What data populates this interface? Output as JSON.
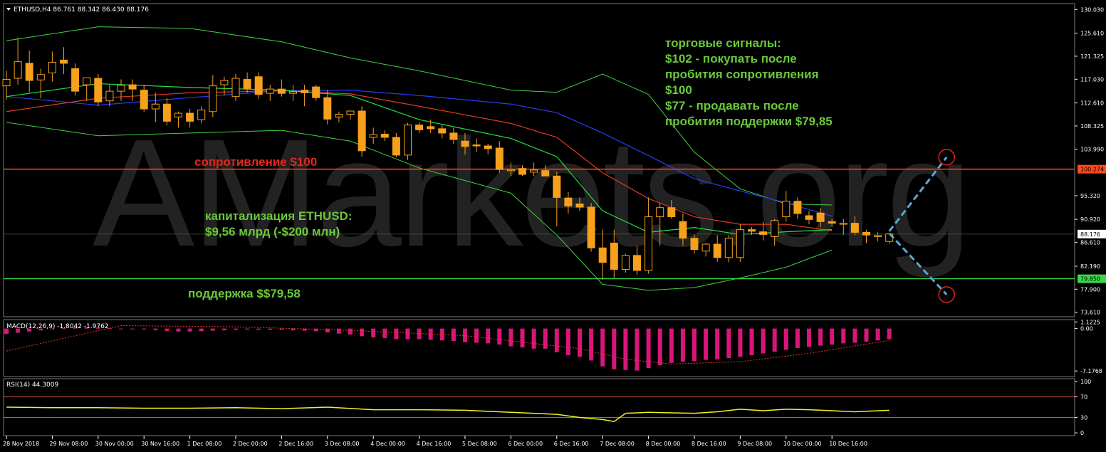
{
  "chart_data": [
    {
      "type": "candlestick",
      "symbol_header": "ETHUSD,H4  86.761 88.342 86.430 88.176",
      "watermark": "AMarkets.org",
      "price_axis_ticks": [
        "130.030",
        "125.610",
        "121.325",
        "117.030",
        "112.610",
        "108.325",
        "103.990",
        "95.320",
        "90.920",
        "86.610",
        "82.190",
        "77.900",
        "73.610"
      ],
      "price_axis_values": [
        130.03,
        125.61,
        121.325,
        117.03,
        112.61,
        108.325,
        103.99,
        95.32,
        90.92,
        86.61,
        82.19,
        77.9,
        73.61
      ],
      "ylim": [
        72.9,
        131.0
      ],
      "time_labels": [
        "28 Nov 2018",
        "29 Nov 08:00",
        "30 Nov 00:00",
        "30 Nov 16:00",
        "1 Dec 08:00",
        "2 Dec 00:00",
        "2 Dec 16:00",
        "3 Dec 08:00",
        "4 Dec 00:00",
        "4 Dec 16:00",
        "5 Dec 08:00",
        "6 Dec 00:00",
        "6 Dec 16:00",
        "7 Dec 08:00",
        "8 Dec 00:00",
        "8 Dec 16:00",
        "9 Dec 08:00",
        "10 Dec 00:00",
        "10 Dec 16:00"
      ],
      "time_label_index": [
        0,
        4,
        8,
        12,
        16,
        20,
        24,
        28,
        32,
        36,
        40,
        44,
        48,
        52,
        56,
        60,
        64,
        68,
        72
      ],
      "candles": [
        {
          "o": 115.8,
          "h": 118.6,
          "l": 113.2,
          "c": 117.0
        },
        {
          "o": 117.2,
          "h": 124.8,
          "l": 116.0,
          "c": 120.3
        },
        {
          "o": 120.0,
          "h": 122.4,
          "l": 114.6,
          "c": 116.8
        },
        {
          "o": 116.9,
          "h": 119.0,
          "l": 113.5,
          "c": 117.9
        },
        {
          "o": 118.2,
          "h": 122.2,
          "l": 116.6,
          "c": 120.2
        },
        {
          "o": 120.6,
          "h": 123.0,
          "l": 118.0,
          "c": 120.0
        },
        {
          "o": 119.0,
          "h": 120.0,
          "l": 114.0,
          "c": 114.8
        },
        {
          "o": 116.0,
          "h": 117.0,
          "l": 113.0,
          "c": 117.3
        },
        {
          "o": 117.2,
          "h": 118.0,
          "l": 112.0,
          "c": 112.8
        },
        {
          "o": 113.0,
          "h": 116.0,
          "l": 112.0,
          "c": 114.8
        },
        {
          "o": 114.8,
          "h": 117.0,
          "l": 113.0,
          "c": 115.9
        },
        {
          "o": 116.0,
          "h": 117.0,
          "l": 113.0,
          "c": 115.2
        },
        {
          "o": 115.0,
          "h": 116.0,
          "l": 111.0,
          "c": 111.5
        },
        {
          "o": 111.5,
          "h": 114.5,
          "l": 109.0,
          "c": 112.4
        },
        {
          "o": 112.4,
          "h": 113.5,
          "l": 108.4,
          "c": 109.2
        },
        {
          "o": 110.0,
          "h": 111.0,
          "l": 108.0,
          "c": 110.7
        },
        {
          "o": 110.7,
          "h": 111.5,
          "l": 108.0,
          "c": 109.2
        },
        {
          "o": 109.5,
          "h": 112.0,
          "l": 108.8,
          "c": 111.3
        },
        {
          "o": 111.0,
          "h": 117.8,
          "l": 110.0,
          "c": 115.8
        },
        {
          "o": 116.0,
          "h": 117.5,
          "l": 114.0,
          "c": 116.8
        },
        {
          "o": 113.8,
          "h": 118.0,
          "l": 113.0,
          "c": 117.2
        },
        {
          "o": 117.0,
          "h": 118.3,
          "l": 114.5,
          "c": 115.3
        },
        {
          "o": 117.5,
          "h": 118.3,
          "l": 113.4,
          "c": 114.2
        },
        {
          "o": 114.4,
          "h": 116.0,
          "l": 113.0,
          "c": 115.2
        },
        {
          "o": 115.2,
          "h": 117.0,
          "l": 113.8,
          "c": 114.4
        },
        {
          "o": 114.4,
          "h": 116.0,
          "l": 113.0,
          "c": 114.7
        },
        {
          "o": 115.0,
          "h": 116.0,
          "l": 112.0,
          "c": 114.5
        },
        {
          "o": 115.6,
          "h": 116.0,
          "l": 113.0,
          "c": 113.6
        },
        {
          "o": 113.6,
          "h": 115.0,
          "l": 108.6,
          "c": 109.6
        },
        {
          "o": 110.0,
          "h": 111.0,
          "l": 109.0,
          "c": 110.5
        },
        {
          "o": 110.5,
          "h": 111.0,
          "l": 109.5,
          "c": 111.1
        },
        {
          "o": 111.1,
          "h": 112.0,
          "l": 102.6,
          "c": 103.7
        },
        {
          "o": 106.2,
          "h": 108.0,
          "l": 105.0,
          "c": 106.7
        },
        {
          "o": 106.8,
          "h": 107.5,
          "l": 105.5,
          "c": 106.2
        },
        {
          "o": 106.2,
          "h": 107.0,
          "l": 102.5,
          "c": 102.9
        },
        {
          "o": 102.9,
          "h": 108.9,
          "l": 102.0,
          "c": 108.5
        },
        {
          "o": 108.5,
          "h": 109.0,
          "l": 107.0,
          "c": 107.6
        },
        {
          "o": 108.2,
          "h": 109.5,
          "l": 107.0,
          "c": 107.8
        },
        {
          "o": 107.8,
          "h": 108.5,
          "l": 106.0,
          "c": 107.0
        },
        {
          "o": 107.0,
          "h": 108.0,
          "l": 105.0,
          "c": 105.8
        },
        {
          "o": 105.5,
          "h": 107.0,
          "l": 103.0,
          "c": 104.5
        },
        {
          "o": 104.8,
          "h": 106.0,
          "l": 103.5,
          "c": 104.6
        },
        {
          "o": 104.6,
          "h": 105.0,
          "l": 103.0,
          "c": 104.1
        },
        {
          "o": 104.2,
          "h": 105.5,
          "l": 99.6,
          "c": 100.2
        },
        {
          "o": 100.0,
          "h": 101.5,
          "l": 99.0,
          "c": 100.2
        },
        {
          "o": 100.4,
          "h": 101.0,
          "l": 99.0,
          "c": 99.3
        },
        {
          "o": 99.7,
          "h": 101.5,
          "l": 99.0,
          "c": 100.1
        },
        {
          "o": 100.0,
          "h": 101.0,
          "l": 99.0,
          "c": 99.0
        },
        {
          "o": 99.0,
          "h": 99.8,
          "l": 89.6,
          "c": 95.0
        },
        {
          "o": 94.9,
          "h": 96.0,
          "l": 92.0,
          "c": 93.4
        },
        {
          "o": 93.8,
          "h": 95.0,
          "l": 92.5,
          "c": 93.2
        },
        {
          "o": 93.2,
          "h": 94.0,
          "l": 84.9,
          "c": 85.6
        },
        {
          "o": 85.6,
          "h": 89.0,
          "l": 79.7,
          "c": 82.9
        },
        {
          "o": 86.5,
          "h": 89.0,
          "l": 80.0,
          "c": 81.6
        },
        {
          "o": 81.6,
          "h": 84.5,
          "l": 81.0,
          "c": 84.2
        },
        {
          "o": 84.2,
          "h": 86.0,
          "l": 80.5,
          "c": 81.4
        },
        {
          "o": 81.4,
          "h": 95.0,
          "l": 80.8,
          "c": 91.4
        },
        {
          "o": 91.4,
          "h": 94.0,
          "l": 86.0,
          "c": 93.1
        },
        {
          "o": 93.1,
          "h": 94.5,
          "l": 91.0,
          "c": 91.4
        },
        {
          "o": 90.5,
          "h": 92.0,
          "l": 86.0,
          "c": 87.4
        },
        {
          "o": 87.4,
          "h": 88.0,
          "l": 84.5,
          "c": 85.3
        },
        {
          "o": 85.0,
          "h": 86.5,
          "l": 84.0,
          "c": 86.3
        },
        {
          "o": 86.3,
          "h": 88.0,
          "l": 83.0,
          "c": 83.8
        },
        {
          "o": 83.8,
          "h": 88.0,
          "l": 82.9,
          "c": 87.4
        },
        {
          "o": 83.8,
          "h": 90.0,
          "l": 83.0,
          "c": 89.0
        },
        {
          "o": 89.0,
          "h": 89.5,
          "l": 88.0,
          "c": 88.7
        },
        {
          "o": 88.6,
          "h": 90.5,
          "l": 87.0,
          "c": 88.1
        },
        {
          "o": 87.7,
          "h": 91.0,
          "l": 86.0,
          "c": 90.7
        },
        {
          "o": 91.4,
          "h": 96.2,
          "l": 90.5,
          "c": 94.3
        },
        {
          "o": 94.3,
          "h": 95.0,
          "l": 91.0,
          "c": 92.0
        },
        {
          "o": 91.6,
          "h": 92.5,
          "l": 90.0,
          "c": 90.9
        },
        {
          "o": 92.1,
          "h": 93.0,
          "l": 89.5,
          "c": 90.5
        },
        {
          "o": 90.5,
          "h": 91.0,
          "l": 89.5,
          "c": 90.2
        },
        {
          "o": 90.2,
          "h": 91.0,
          "l": 88.0,
          "c": 90.2
        },
        {
          "o": 90.2,
          "h": 91.5,
          "l": 88.0,
          "c": 88.5
        },
        {
          "o": 88.5,
          "h": 89.0,
          "l": 86.5,
          "c": 88.0
        },
        {
          "o": 87.8,
          "h": 88.5,
          "l": 86.8,
          "c": 87.9
        },
        {
          "o": 86.8,
          "h": 88.3,
          "l": 86.4,
          "c": 88.2
        }
      ],
      "bollinger_upper": {
        "x": [
          0,
          8,
          16,
          24,
          30,
          36,
          44,
          48,
          52,
          56,
          60,
          64,
          68,
          72
        ],
        "y": [
          124.2,
          126.8,
          126.5,
          124.0,
          121.0,
          118.6,
          115.0,
          114.6,
          118.0,
          114.2,
          103.4,
          96.6,
          93.8,
          93.6
        ]
      },
      "bollinger_lower": {
        "x": [
          0,
          8,
          16,
          24,
          30,
          36,
          44,
          48,
          52,
          56,
          60,
          64,
          68,
          72
        ],
        "y": [
          109.0,
          106.5,
          107.0,
          107.5,
          105.5,
          100.5,
          95.8,
          88.0,
          78.8,
          77.7,
          78.2,
          80.0,
          82.0,
          85.2
        ]
      },
      "ma_green": {
        "x": [
          0,
          8,
          16,
          24,
          30,
          36,
          44,
          48,
          52,
          56,
          60,
          64,
          68,
          72
        ],
        "y": [
          113.8,
          116.2,
          115.5,
          115.0,
          114.0,
          109.5,
          106.0,
          102.6,
          92.5,
          88.5,
          89.4,
          88.1,
          88.6,
          89.0
        ]
      },
      "ma_red": {
        "x": [
          0,
          8,
          16,
          24,
          30,
          36,
          44,
          48,
          52,
          56,
          60,
          64,
          68,
          72
        ],
        "y": [
          111.0,
          113.5,
          114.5,
          114.9,
          114.3,
          112.0,
          108.8,
          106.2,
          99.6,
          94.8,
          91.4,
          90.0,
          90.0,
          88.8
        ]
      },
      "ma_blue": {
        "x": [
          0,
          8,
          16,
          24,
          30,
          36,
          44,
          48,
          52,
          56,
          60,
          64,
          68,
          72
        ],
        "y": [
          113.8,
          112.2,
          113.6,
          114.9,
          115.0,
          114.0,
          112.4,
          110.8,
          107.0,
          102.8,
          98.5,
          96.2,
          94.0,
          91.5
        ]
      },
      "current_price": "88.176",
      "current_price_value": 88.176,
      "resistance": {
        "value": 100.274,
        "label": "100.274",
        "text": "сопротивление $100",
        "color": "#ff4a1c"
      },
      "support": {
        "value": 79.85,
        "label": "79.850",
        "text": "поддержка $$79,58",
        "color": "#38d84a"
      },
      "annotation_signals": [
        "торговые сигналы:",
        "$102 - покупать после",
        "пробития сопротивления",
        "$100",
        "$77 - продавать после",
        "пробития поддержки $79,85"
      ],
      "annotation_cap": [
        "капитализация ETHUSD:",
        "$9,56 млрд (-$200 млн)"
      ],
      "projection_up": {
        "from_x": 77,
        "from_y": 88.7,
        "to_x": 82,
        "to_y": 102.5
      },
      "projection_down": {
        "from_x": 77,
        "from_y": 88.3,
        "to_x": 82,
        "to_y": 76.9
      },
      "colors": {
        "bull": "#f7a01c",
        "bear": "#f7a01c",
        "bb": "#3fd23f",
        "ma_green": "#22e044",
        "ma_red": "#e43a1f",
        "ma_blue": "#2a3cf0",
        "grid": "#2a2a2a",
        "axis": "#ffffff",
        "projection": "#5aa8d8",
        "circle": "#e81f1f"
      }
    },
    {
      "type": "bar",
      "title": "MACD(12,26,9) -1.8042 -1.9762",
      "axis_labels": [
        "1.1225",
        "0.00",
        "-7.1768"
      ],
      "axis_values": [
        1.1225,
        0,
        -7.1768
      ],
      "ylim": [
        -8.0,
        1.4
      ],
      "histogram": [
        -0.9,
        -0.7,
        -0.5,
        -0.3,
        -0.1,
        0.05,
        0.15,
        0.2,
        0.15,
        0.05,
        0.0,
        -0.05,
        -0.15,
        -0.25,
        -0.4,
        -0.5,
        -0.5,
        -0.45,
        -0.35,
        -0.3,
        -0.2,
        -0.15,
        -0.2,
        -0.2,
        -0.2,
        -0.3,
        -0.35,
        -0.45,
        -0.65,
        -0.85,
        -1.0,
        -1.3,
        -1.5,
        -1.6,
        -1.8,
        -1.8,
        -1.8,
        -1.9,
        -2.0,
        -2.1,
        -2.3,
        -2.4,
        -2.5,
        -2.7,
        -3.0,
        -3.2,
        -3.4,
        -3.4,
        -4.0,
        -4.5,
        -4.8,
        -5.4,
        -6.4,
        -6.9,
        -7.0,
        -7.1,
        -6.7,
        -6.2,
        -5.8,
        -5.6,
        -5.5,
        -5.3,
        -5.2,
        -5.0,
        -4.8,
        -4.5,
        -4.2,
        -3.9,
        -3.6,
        -3.3,
        -3.1,
        -2.9,
        -2.7,
        -2.5,
        -2.4,
        -2.2,
        -2.0,
        -1.8
      ],
      "signal_line": {
        "x": [
          0,
          10,
          20,
          30,
          40,
          50,
          54,
          58,
          64,
          70,
          77
        ],
        "y": [
          -3.8,
          0.5,
          0.3,
          -0.3,
          -1.2,
          -3.4,
          -5.2,
          -6.0,
          -5.6,
          -4.2,
          -2.0
        ]
      },
      "colors": {
        "hist": "#d8167a",
        "signal": "#e43a1f"
      }
    },
    {
      "type": "line",
      "title": "RSI(14) 44.3009",
      "axis_labels": [
        "100",
        "70",
        "30",
        "0"
      ],
      "axis_values": [
        100,
        70,
        30,
        0
      ],
      "ylim": [
        -4,
        104
      ],
      "levels": [
        70,
        30
      ],
      "x": [
        0,
        4,
        8,
        12,
        16,
        20,
        24,
        28,
        32,
        36,
        40,
        44,
        48,
        50,
        52,
        53,
        54,
        56,
        58,
        60,
        62,
        64,
        66,
        68,
        70,
        72,
        74,
        77
      ],
      "y": [
        50,
        49,
        49,
        48,
        48,
        49,
        47,
        50,
        45,
        45,
        44,
        40,
        36,
        30,
        26,
        22,
        38,
        40,
        39,
        38,
        41,
        46,
        43,
        46,
        45,
        43,
        41,
        44
      ],
      "colors": {
        "line": "#f3f020",
        "level": "#e76838"
      }
    }
  ]
}
